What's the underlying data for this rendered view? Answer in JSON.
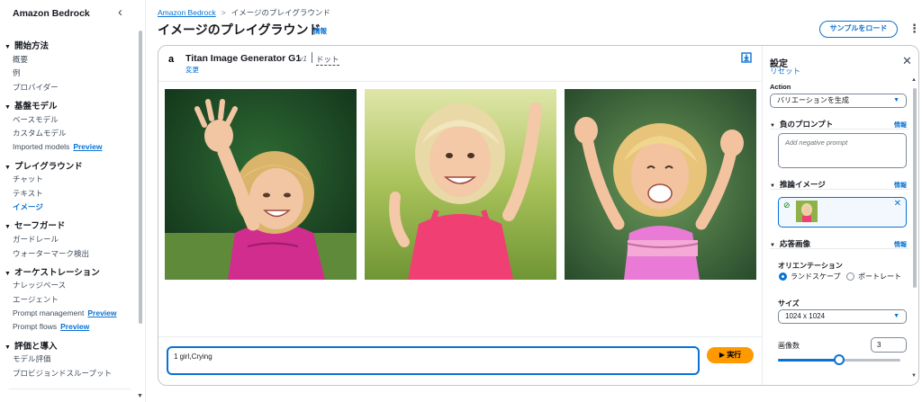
{
  "sidebar": {
    "title": "Amazon Bedrock",
    "sections": [
      {
        "label": "開始方法",
        "items": [
          {
            "label": "概要"
          },
          {
            "label": "例"
          },
          {
            "label": "プロバイダー"
          }
        ]
      },
      {
        "label": "基盤モデル",
        "items": [
          {
            "label": "ベースモデル"
          },
          {
            "label": "カスタムモデル"
          },
          {
            "label": "Imported models",
            "badge": "Preview"
          }
        ]
      },
      {
        "label": "プレイグラウンド",
        "items": [
          {
            "label": "チャット"
          },
          {
            "label": "テキスト"
          },
          {
            "label": "イメージ",
            "active": true
          }
        ]
      },
      {
        "label": "セーフガード",
        "items": [
          {
            "label": "ガードレール"
          },
          {
            "label": "ウォーターマーク検出"
          }
        ]
      },
      {
        "label": "オーケストレーション",
        "items": [
          {
            "label": "ナレッジベース"
          },
          {
            "label": "エージェント"
          },
          {
            "label": "Prompt management",
            "badge": "Preview"
          },
          {
            "label": "Prompt flows",
            "badge": "Preview"
          }
        ]
      },
      {
        "label": "評価と導入",
        "items": [
          {
            "label": "モデル評価"
          },
          {
            "label": "プロビジョンドスループット"
          }
        ]
      }
    ]
  },
  "breadcrumb": {
    "root": "Amazon Bedrock",
    "current": "イメージのプレイグラウンド"
  },
  "header": {
    "title": "イメージのプレイグラウンド",
    "info": "情報",
    "load_sample": "サンプルをロード",
    "more": "⋮"
  },
  "model": {
    "name": "Titan Image Generator G1",
    "version": "v1",
    "mode": "ドット",
    "change": "変更",
    "logo": "a"
  },
  "images": [
    {
      "bg": "#1f4a2a",
      "pose": "reach",
      "label": "Generated image 1"
    },
    {
      "bg": "#8fb14a",
      "pose": "wave",
      "label": "Generated image 2"
    },
    {
      "bg": "#3c6b3c",
      "pose": "cheer",
      "label": "Generated image 3"
    }
  ],
  "prompt": {
    "value": "1 girl,Crying",
    "run_label": "実行"
  },
  "settings": {
    "title": "設定",
    "reset": "リセット",
    "action_label": "Action",
    "action_value": "バリエーションを生成",
    "negative": {
      "label": "負のプロンプト",
      "info": "情報",
      "placeholder": "Add negative prompt"
    },
    "reference": {
      "label": "推論イメージ",
      "info": "情報"
    },
    "response": {
      "label": "応答画像",
      "info": "情報"
    },
    "orientation": {
      "label": "オリエンテーション",
      "landscape": "ランドスケープ",
      "portrait": "ポートレート"
    },
    "size": {
      "label": "サイズ",
      "value": "1024 x 1024"
    },
    "count": {
      "label": "画像数",
      "value": "3",
      "slider_fraction": 0.5
    }
  },
  "colors": {
    "accent": "#0972d3",
    "run": "#ff9900"
  }
}
